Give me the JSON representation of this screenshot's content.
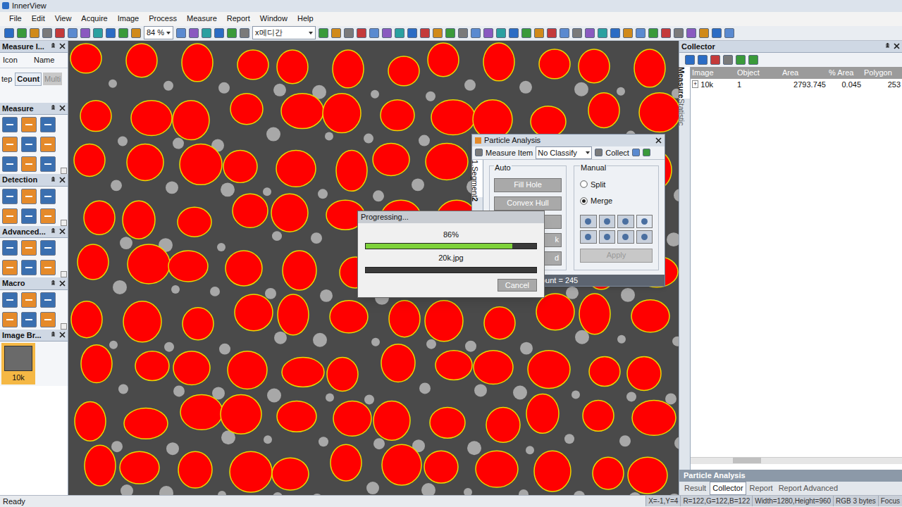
{
  "window": {
    "title": "InnerView"
  },
  "menu": [
    "File",
    "Edit",
    "View",
    "Acquire",
    "Image",
    "Process",
    "Measure",
    "Report",
    "Window",
    "Help"
  ],
  "toolbar": {
    "zoom": "84 %",
    "mode": "x메디간"
  },
  "measure_items": {
    "title": "Measure I...",
    "columns": [
      "Icon",
      "Name"
    ],
    "tabs": [
      {
        "label": "tep",
        "selected": false,
        "disabled": false
      },
      {
        "label": "Count",
        "selected": true,
        "disabled": false
      },
      {
        "label": "Multi",
        "selected": false,
        "disabled": true
      }
    ]
  },
  "tool_panels": [
    {
      "title": "Measure"
    },
    {
      "title": "Detection"
    },
    {
      "title": "Advanced..."
    },
    {
      "title": "Macro"
    }
  ],
  "image_browser": {
    "title": "Image Br...",
    "items": [
      {
        "label": "10k",
        "selected": true
      }
    ]
  },
  "particle_dialog": {
    "title": "Particle Analysis",
    "measure_item": "Measure Item",
    "classify": "No Classify",
    "collect": "Collect",
    "side_tabs": [
      {
        "label": "1.Segment",
        "selected": true
      },
      {
        "label": "2",
        "selected": false
      }
    ],
    "auto": {
      "title": "Auto",
      "buttons": [
        "Fill Hole",
        "Convex Hull",
        "",
        "k",
        "d"
      ]
    },
    "manual": {
      "title": "Manual",
      "options": [
        {
          "label": "Split",
          "selected": false
        },
        {
          "label": "Merge",
          "selected": true
        }
      ],
      "apply": {
        "label": "Apply",
        "disabled": true
      }
    },
    "status": "Count = 245"
  },
  "progress": {
    "title": "Progressing...",
    "bars": [
      {
        "reading": "86%",
        "level": 0.86
      },
      {
        "reading": "20k.jpg",
        "level": 0
      }
    ],
    "cancel": "Cancel"
  },
  "collector": {
    "title": "Collector",
    "side_tabs": [
      {
        "label": "Measure",
        "selected": true
      },
      {
        "label": "Statistic",
        "selected": false
      }
    ],
    "columns": [
      "Image",
      "Object",
      "Area",
      "% Area",
      "Polygon"
    ],
    "rows": [
      {
        "expand": "+",
        "cells": [
          "10k",
          "1",
          "2793.745",
          "0.045",
          "253"
        ]
      }
    ]
  },
  "bottom_panel": {
    "title": "Particle Analysis",
    "tabs": [
      {
        "label": "Result",
        "selected": false
      },
      {
        "label": "Collector",
        "selected": true
      },
      {
        "label": "Report",
        "selected": false
      },
      {
        "label": "Report Advanced",
        "selected": false
      }
    ]
  },
  "status_bar": {
    "left": "Ready",
    "fields": [
      "X=-1,Y=4",
      "R=122,G=122,B=122",
      "Width=1280,Height=960",
      "RGB 3 bytes",
      "Focus"
    ]
  }
}
